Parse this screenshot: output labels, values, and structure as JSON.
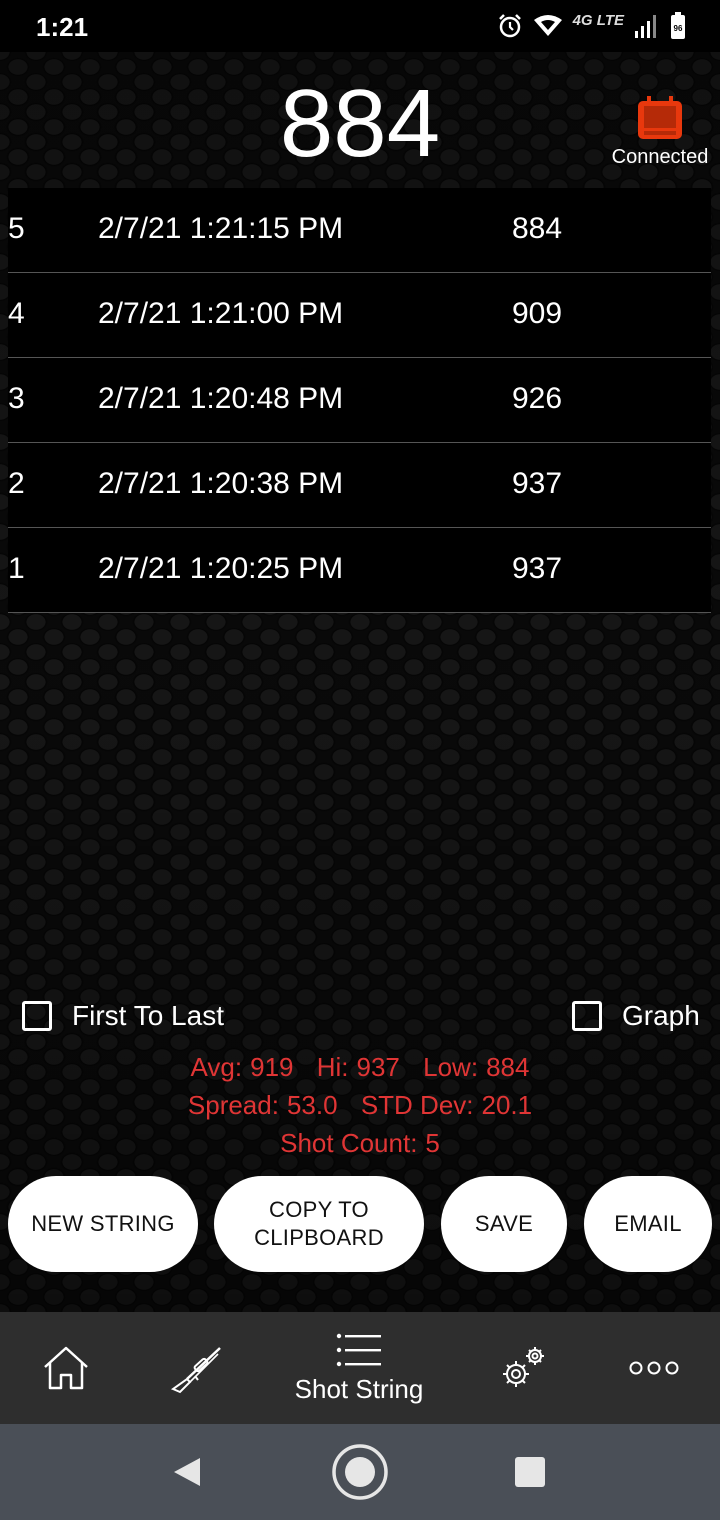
{
  "status_bar": {
    "time": "1:21",
    "network": "4G LTE",
    "battery": "96"
  },
  "header": {
    "current_reading": "884",
    "connection_status": "Connected"
  },
  "shots": [
    {
      "num": "5",
      "datetime": "2/7/21 1:21:15 PM",
      "velocity": "884"
    },
    {
      "num": "4",
      "datetime": "2/7/21 1:21:00 PM",
      "velocity": "909"
    },
    {
      "num": "3",
      "datetime": "2/7/21 1:20:48 PM",
      "velocity": "926"
    },
    {
      "num": "2",
      "datetime": "2/7/21 1:20:38 PM",
      "velocity": "937"
    },
    {
      "num": "1",
      "datetime": "2/7/21 1:20:25 PM",
      "velocity": "937"
    }
  ],
  "options": {
    "first_to_last": "First To Last",
    "graph": "Graph"
  },
  "stats": {
    "avg_label": "Avg:",
    "avg": "919",
    "hi_label": "Hi:",
    "hi": "937",
    "low_label": "Low:",
    "low": "884",
    "spread_label": "Spread:",
    "spread": "53.0",
    "std_label": "STD Dev:",
    "std": "20.1",
    "count_label": "Shot Count:",
    "count": "5",
    "color": "#e03535"
  },
  "buttons": {
    "new_string": "NEW STRING",
    "copy_line1": "COPY TO",
    "copy_line2": "CLIPBOARD",
    "save": "SAVE",
    "email": "EMAIL"
  },
  "bottom_nav": {
    "items": [
      {
        "icon": "home-icon"
      },
      {
        "icon": "rifle-icon"
      },
      {
        "icon": "list-icon",
        "label": "Shot String",
        "active": true
      },
      {
        "icon": "gears-icon"
      },
      {
        "icon": "more-icon"
      }
    ]
  },
  "system_nav": {
    "icons": [
      "back-icon",
      "home-circle-icon",
      "recents-icon"
    ]
  },
  "colors": {
    "connected_icon": "#e8380d",
    "nav_bg": "#2e2e2e",
    "sys_nav_bg": "#4a4f57"
  }
}
